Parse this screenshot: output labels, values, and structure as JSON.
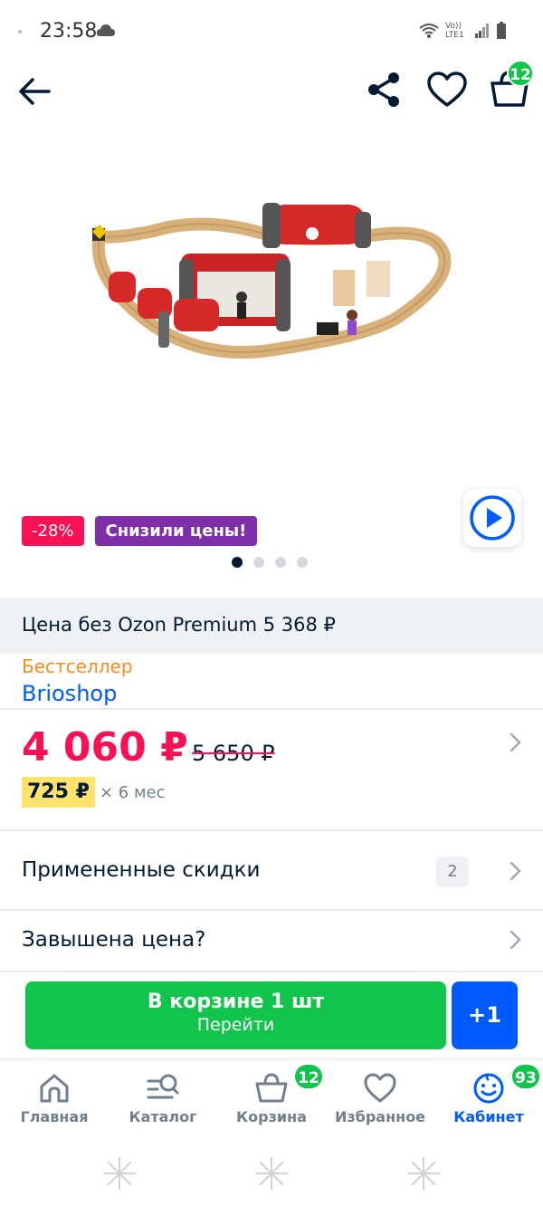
{
  "status_bar": {
    "time": "23:58",
    "network_label": "Vo)) LTE1"
  },
  "toolbar": {
    "cart_badge": "12"
  },
  "product": {
    "discount_badge": "-28%",
    "promo_badge": "Снизили цены!",
    "gallery_count": 4,
    "gallery_active": 0
  },
  "premium": {
    "text": "Цена без Ozon Premium 5 368 ₽"
  },
  "seller": {
    "bestseller_label": "Бестселлер",
    "brand": "Brioshop"
  },
  "price": {
    "current": "4 060 ₽",
    "old": "5 650 ₽",
    "installment_amount": "725 ₽",
    "installment_period": "× 6 мес"
  },
  "rows": {
    "discounts_label": "Примененные скидки",
    "discounts_count": "2",
    "overpriced_label": "Завышена цена?"
  },
  "cart_action": {
    "title": "В корзине 1 шт",
    "subtitle": "Перейти",
    "plus_label": "+1"
  },
  "bottom_nav": {
    "items": [
      {
        "label": "Главная",
        "icon": "home-icon"
      },
      {
        "label": "Каталог",
        "icon": "catalog-search-icon"
      },
      {
        "label": "Корзина",
        "icon": "basket-icon",
        "badge": "12"
      },
      {
        "label": "Избранное",
        "icon": "heart-icon"
      },
      {
        "label": "Кабинет",
        "icon": "smiley-face-icon",
        "badge": "93",
        "active": true
      }
    ]
  },
  "colors": {
    "price": "#f91155",
    "accent_blue": "#005bff",
    "green": "#10c44c",
    "promo_purple": "#7e2fa8",
    "bestseller_orange": "#f58c1e",
    "installment_yellow": "#ffe36c"
  }
}
